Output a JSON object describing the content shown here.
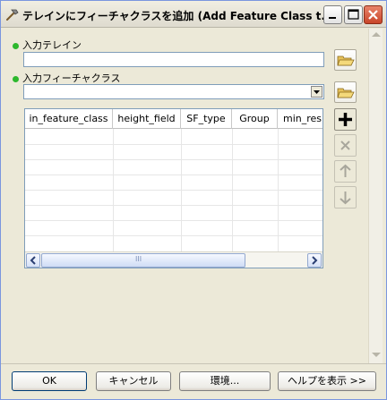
{
  "window": {
    "title": "テレインにフィーチャクラスを追加 (Add Feature Class t..."
  },
  "form": {
    "input_terrain_label": "入力テレイン",
    "input_terrain_value": "",
    "input_fc_label": "入力フィーチャクラス",
    "input_fc_value": ""
  },
  "table": {
    "columns": [
      "in_feature_class",
      "height_field",
      "SF_type",
      "Group",
      "min_res"
    ],
    "rows": [],
    "hscroll_grip": "III"
  },
  "buttons": {
    "ok": "OK",
    "cancel": "キャンセル",
    "environments": "環境...",
    "help": "ヘルプを表示 >>"
  },
  "icons": {
    "title": "hammer-icon",
    "minimize": "minimize-icon",
    "maximize": "maximize-icon",
    "close": "close-icon",
    "folder": "open-folder-icon",
    "add": "plus-icon",
    "remove": "x-icon",
    "up": "arrow-up-icon",
    "down": "arrow-down-icon",
    "required": "green-dot-icon"
  },
  "colors": {
    "required_dot": "#2db82d",
    "close_button": "#c8452a",
    "window_bg": "#ece9d8"
  }
}
